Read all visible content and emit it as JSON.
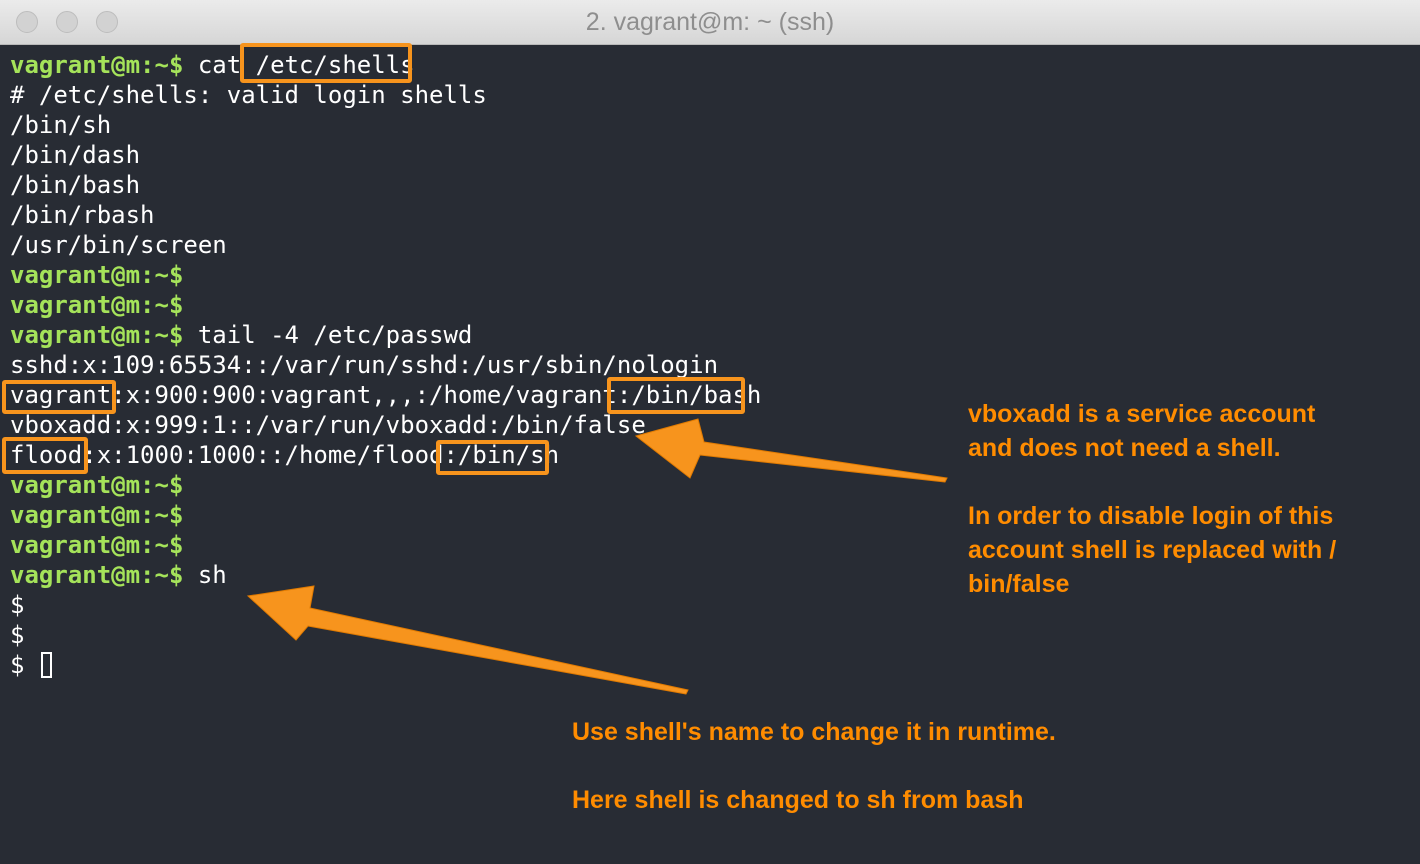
{
  "window": {
    "title": "2. vagrant@m: ~ (ssh)"
  },
  "terminal": {
    "prompt": "vagrant@m:~$",
    "lines": [
      {
        "prompt": true,
        "text": " cat /etc/shells"
      },
      {
        "prompt": false,
        "text": "# /etc/shells: valid login shells"
      },
      {
        "prompt": false,
        "text": "/bin/sh"
      },
      {
        "prompt": false,
        "text": "/bin/dash"
      },
      {
        "prompt": false,
        "text": "/bin/bash"
      },
      {
        "prompt": false,
        "text": "/bin/rbash"
      },
      {
        "prompt": false,
        "text": "/usr/bin/screen"
      },
      {
        "prompt": true,
        "text": ""
      },
      {
        "prompt": true,
        "text": ""
      },
      {
        "prompt": true,
        "text": " tail -4 /etc/passwd"
      },
      {
        "prompt": false,
        "text": "sshd:x:109:65534::/var/run/sshd:/usr/sbin/nologin"
      },
      {
        "prompt": false,
        "text": "vagrant:x:900:900:vagrant,,,:/home/vagrant:/bin/bash"
      },
      {
        "prompt": false,
        "text": "vboxadd:x:999:1::/var/run/vboxadd:/bin/false"
      },
      {
        "prompt": false,
        "text": "flood:x:1000:1000::/home/flood:/bin/sh"
      },
      {
        "prompt": true,
        "text": ""
      },
      {
        "prompt": true,
        "text": ""
      },
      {
        "prompt": true,
        "text": ""
      },
      {
        "prompt": true,
        "text": " sh"
      },
      {
        "prompt": false,
        "text": "$"
      },
      {
        "prompt": false,
        "text": "$"
      },
      {
        "prompt": false,
        "text": "$ ",
        "cursor": true
      }
    ]
  },
  "annotations": {
    "vboxadd_note": {
      "line1": "vboxadd is a service account",
      "line2": "and does not need a shell.",
      "line3": "In order to disable login of this",
      "line4": "account shell is replaced with /",
      "line5": "bin/false"
    },
    "sh_note": {
      "line1": "Use shell's name to change it in runtime.",
      "line2": "Here shell is changed to sh from bash"
    }
  },
  "colors": {
    "background": "#282c34",
    "prompt": "#a5e35a",
    "highlight": "#f7941d",
    "annotation": "#ff8c00"
  }
}
